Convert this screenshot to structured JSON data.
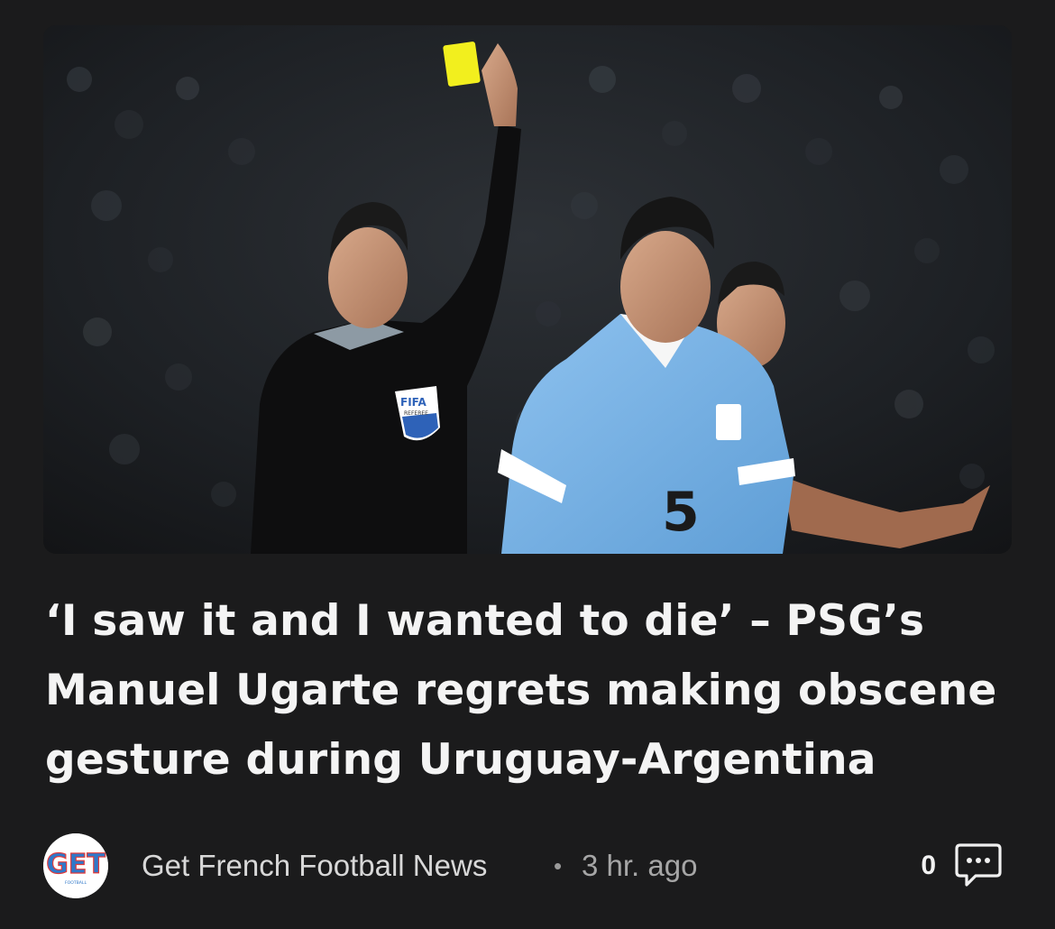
{
  "article": {
    "image_alt": "Referee holding up a yellow card next to a Uruguay player wearing number 5",
    "headline": "‘I saw it and I wanted to die’ – PSG’s Manuel Ugarte regrets making obscene gesture during Uruguay-Argentina",
    "source_name": "Get French Football News",
    "separator": "•",
    "time_ago": "3 hr. ago",
    "comment_count": "0",
    "source_logo_text": "GET",
    "source_logo_subtext": "FOOTBALL"
  },
  "photo_text": {
    "badge": "FIFA",
    "badge_sub": "REFEREE",
    "jersey_number": "5"
  },
  "icons": {
    "comment": "comment-bubble-icon"
  },
  "colors": {
    "background": "#1b1b1c",
    "headline": "#f4f4f4",
    "meta_text": "#d8d8d8",
    "secondary_text": "#a6a6a6",
    "uruguay_blue": "#7ab3e6",
    "yellow_card": "#f2ef1e",
    "logo_blue": "#2f78c9",
    "logo_red": "#e23a3a"
  }
}
